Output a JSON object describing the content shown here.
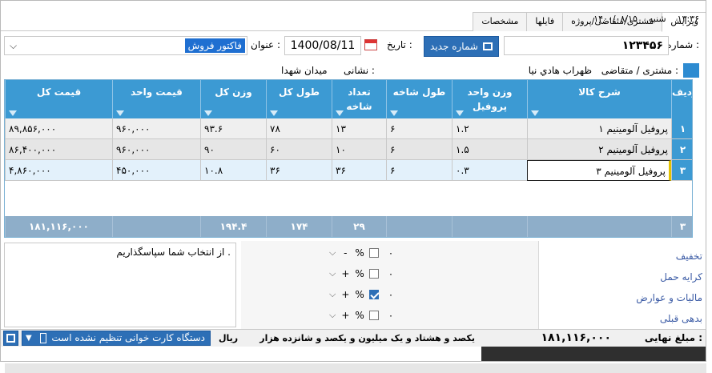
{
  "header": {
    "time": "۱۳:۳۶",
    "weekday": "شنبه",
    "date": "۱۴۰۰/۰۸/۱۵",
    "tabs": [
      "ویرایش",
      "مشتری/متقاضی/پروژه",
      "فایلها",
      "مشخصات"
    ],
    "active_tab": "ویرایش"
  },
  "form": {
    "number_label": "شماره :",
    "number_value": "۱۲۳۴۵۶",
    "new_number_button": "شماره جدید",
    "date_label": "تاریخ :",
    "date_value": "1400/08/11",
    "title_label": "عنوان :",
    "title_value": "فاکتور فروش",
    "customer_label": "مشتری / متقاضی :",
    "customer_value": "ظهراب هادي نيا",
    "address_label": "نشانی :",
    "address_value": "میدان شهدا"
  },
  "grid": {
    "columns": [
      "ردیف",
      "شرح کالا",
      "وزن واحد\nپروفیل",
      "طول شاخه",
      "تعداد\nشاخه",
      "طول کل",
      "وزن کل",
      "قیمت واحد",
      "قیمت کل"
    ],
    "rows": [
      {
        "idx": "۱",
        "desc": "پروفیل آلومینیم ۱",
        "unit_weight": "۱.۲",
        "branch_len": "۶",
        "count": "۱۳",
        "total_len": "۷۸",
        "total_weight": "۹۳.۶",
        "unit_price": "۹۶۰,۰۰۰",
        "total_price": "۸۹,۸۵۶,۰۰۰"
      },
      {
        "idx": "۲",
        "desc": "پروفیل آلومینیم ۲",
        "unit_weight": "۱.۵",
        "branch_len": "۶",
        "count": "۱۰",
        "total_len": "۶۰",
        "total_weight": "۹۰",
        "unit_price": "۹۶۰,۰۰۰",
        "total_price": "۸۶,۴۰۰,۰۰۰"
      },
      {
        "idx": "۳",
        "desc": "پروفیل آلومینیم ۳",
        "unit_weight": "۰.۳",
        "branch_len": "۶",
        "count": "۳۶",
        "total_len": "۳۶",
        "total_weight": "۱۰.۸",
        "unit_price": "۴۵۰,۰۰۰",
        "total_price": "۴,۸۶۰,۰۰۰"
      }
    ],
    "footer": {
      "idx": "۳",
      "count": "۲۹",
      "total_len": "۱۷۴",
      "total_weight": "۱۹۴.۴",
      "total_price": "۱۸۱,۱۱۶,۰۰۰"
    }
  },
  "fees": {
    "items": [
      {
        "label": "تخفیف",
        "sign": "-",
        "checked": false
      },
      {
        "label": "کرایه حمل",
        "sign": "+",
        "checked": false
      },
      {
        "label": "مالیات و عوارض",
        "sign": "+",
        "checked": true
      },
      {
        "label": "بدهی قبلی",
        "sign": "+",
        "checked": false
      }
    ],
    "zero": "۰",
    "percent": "%"
  },
  "notes": {
    "text": "از انتخاب شما سپاسگذاریم ."
  },
  "totals": {
    "final_label": "مبلغ نهایی :",
    "final_value": "۱۸۱,۱۱۶,۰۰۰",
    "in_words": "یکصد و هشتاد و یک میلیون و یکصد و شانزده هزار",
    "currency": "ریال",
    "card_reader": "دستگاه کارت خوانی تنظیم نشده است"
  },
  "colors": {
    "header_blue": "#3c9ad3",
    "button_blue": "#2d6fb6",
    "sum_row": "#8eaec9"
  }
}
